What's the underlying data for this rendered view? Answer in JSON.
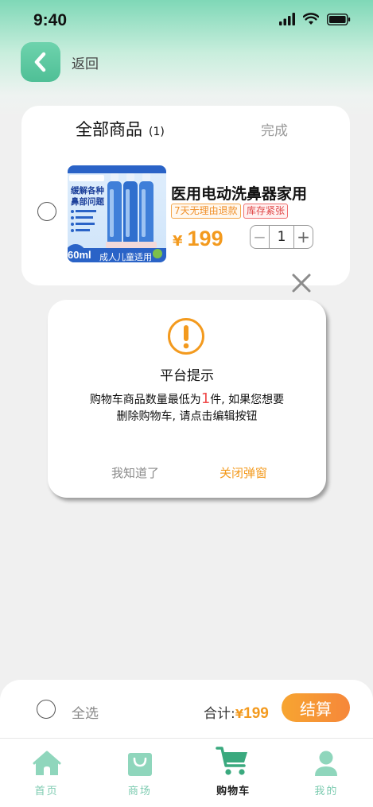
{
  "status_bar": {
    "time": "9:40"
  },
  "nav": {
    "back_label": "返回"
  },
  "cart": {
    "title": "全部商品",
    "count": "(1)",
    "done_label": "完成",
    "item": {
      "name": "医用电动洗鼻器家用",
      "tags": [
        "7天无理由退款",
        "库存紧张"
      ],
      "price_symbol": "¥",
      "price": "199",
      "quantity": "1",
      "minus": "−",
      "plus": "+",
      "image_text": {
        "line1": "缓解各种",
        "line2": "鼻部问题",
        "volume": "60ml",
        "audience": "成人儿童适用"
      }
    }
  },
  "dialog": {
    "title": "平台提示",
    "msg_prefix": "购物车商品数量最低为",
    "msg_highlight": "1",
    "msg_suffix": "件, 如果您想要",
    "msg_line2": "删除购物车, 请点击编辑按钮",
    "acknowledge_label": "我知道了",
    "close_label": "关闭弹窗"
  },
  "footer": {
    "select_all_label": "全选",
    "total_label": "合计:",
    "total_symbol": "¥",
    "total_value": "199",
    "checkout_label": "结算"
  },
  "tabbar": {
    "items": [
      {
        "label": "首页",
        "icon": "home-icon"
      },
      {
        "label": "商场",
        "icon": "shopping-bag-icon"
      },
      {
        "label": "购物车",
        "icon": "cart-icon"
      },
      {
        "label": "我的",
        "icon": "person-icon"
      }
    ],
    "active_index": 2
  },
  "colors": {
    "accent": "#4fbf96",
    "price": "#f39a1e",
    "highlight": "#ef4b4b"
  }
}
